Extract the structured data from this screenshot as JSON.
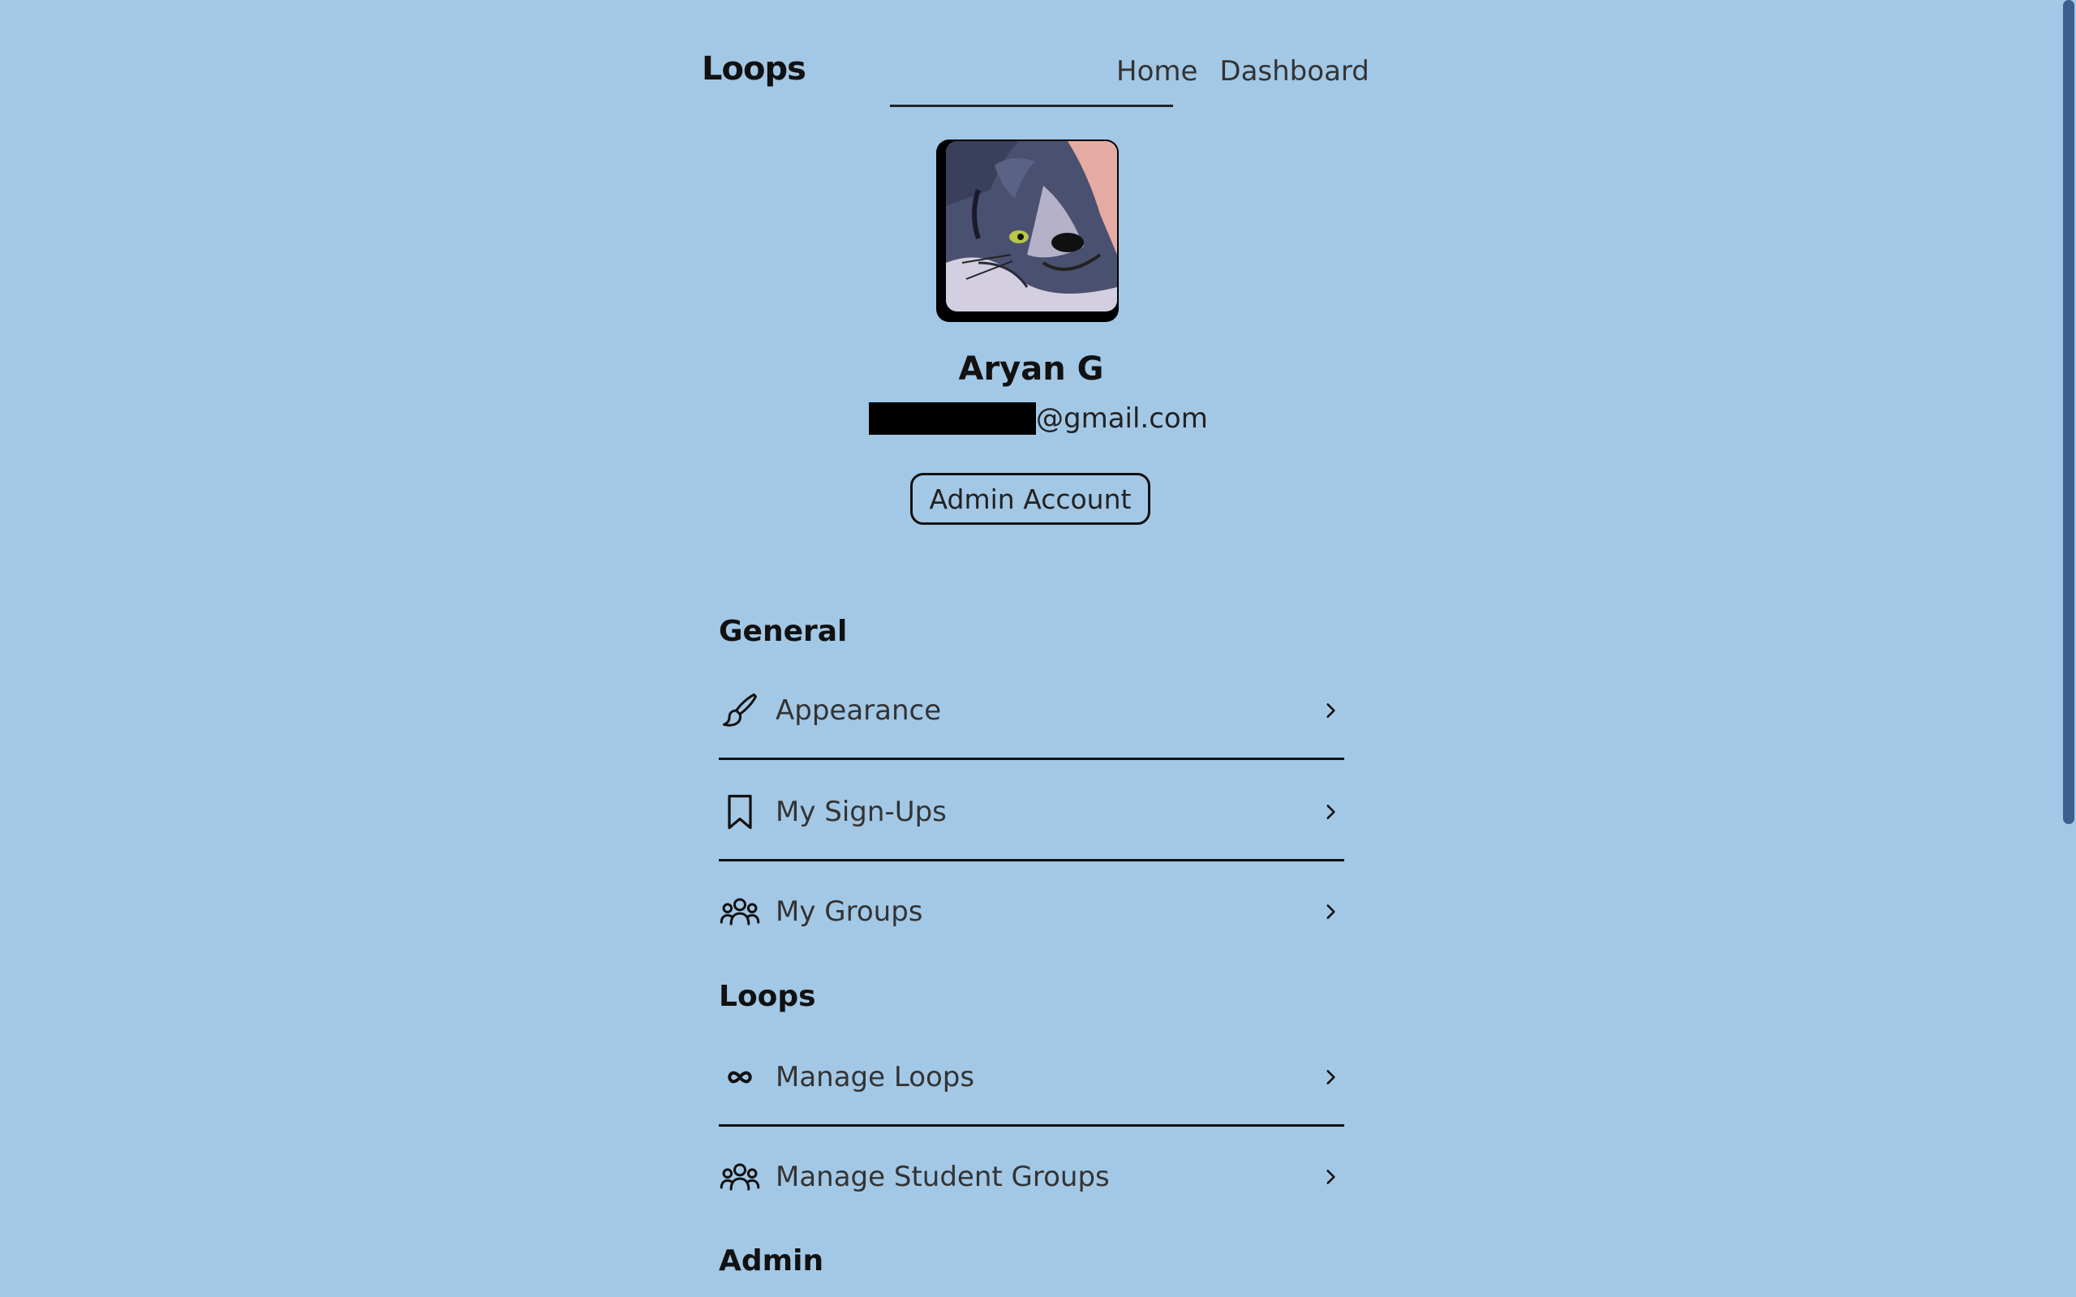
{
  "header": {
    "logo": "Loops",
    "nav": [
      "Home",
      "Dashboard"
    ]
  },
  "profile": {
    "name": "Aryan G",
    "email_suffix": "@gmail.com",
    "role_button": "Admin Account"
  },
  "sections": {
    "general": {
      "title": "General",
      "items": [
        {
          "label": "Appearance",
          "icon": "paintbrush-icon"
        },
        {
          "label": "My Sign-Ups",
          "icon": "bookmark-icon"
        },
        {
          "label": "My Groups",
          "icon": "users-icon"
        }
      ]
    },
    "loops": {
      "title": "Loops",
      "items": [
        {
          "label": "Manage Loops",
          "icon": "infinity-icon"
        },
        {
          "label": "Manage Student Groups",
          "icon": "users-icon"
        }
      ]
    },
    "admin": {
      "title": "Admin"
    }
  },
  "colors": {
    "background": "#a3c8e6",
    "text": "#111111",
    "scrollbar": "#3d5e8f"
  }
}
